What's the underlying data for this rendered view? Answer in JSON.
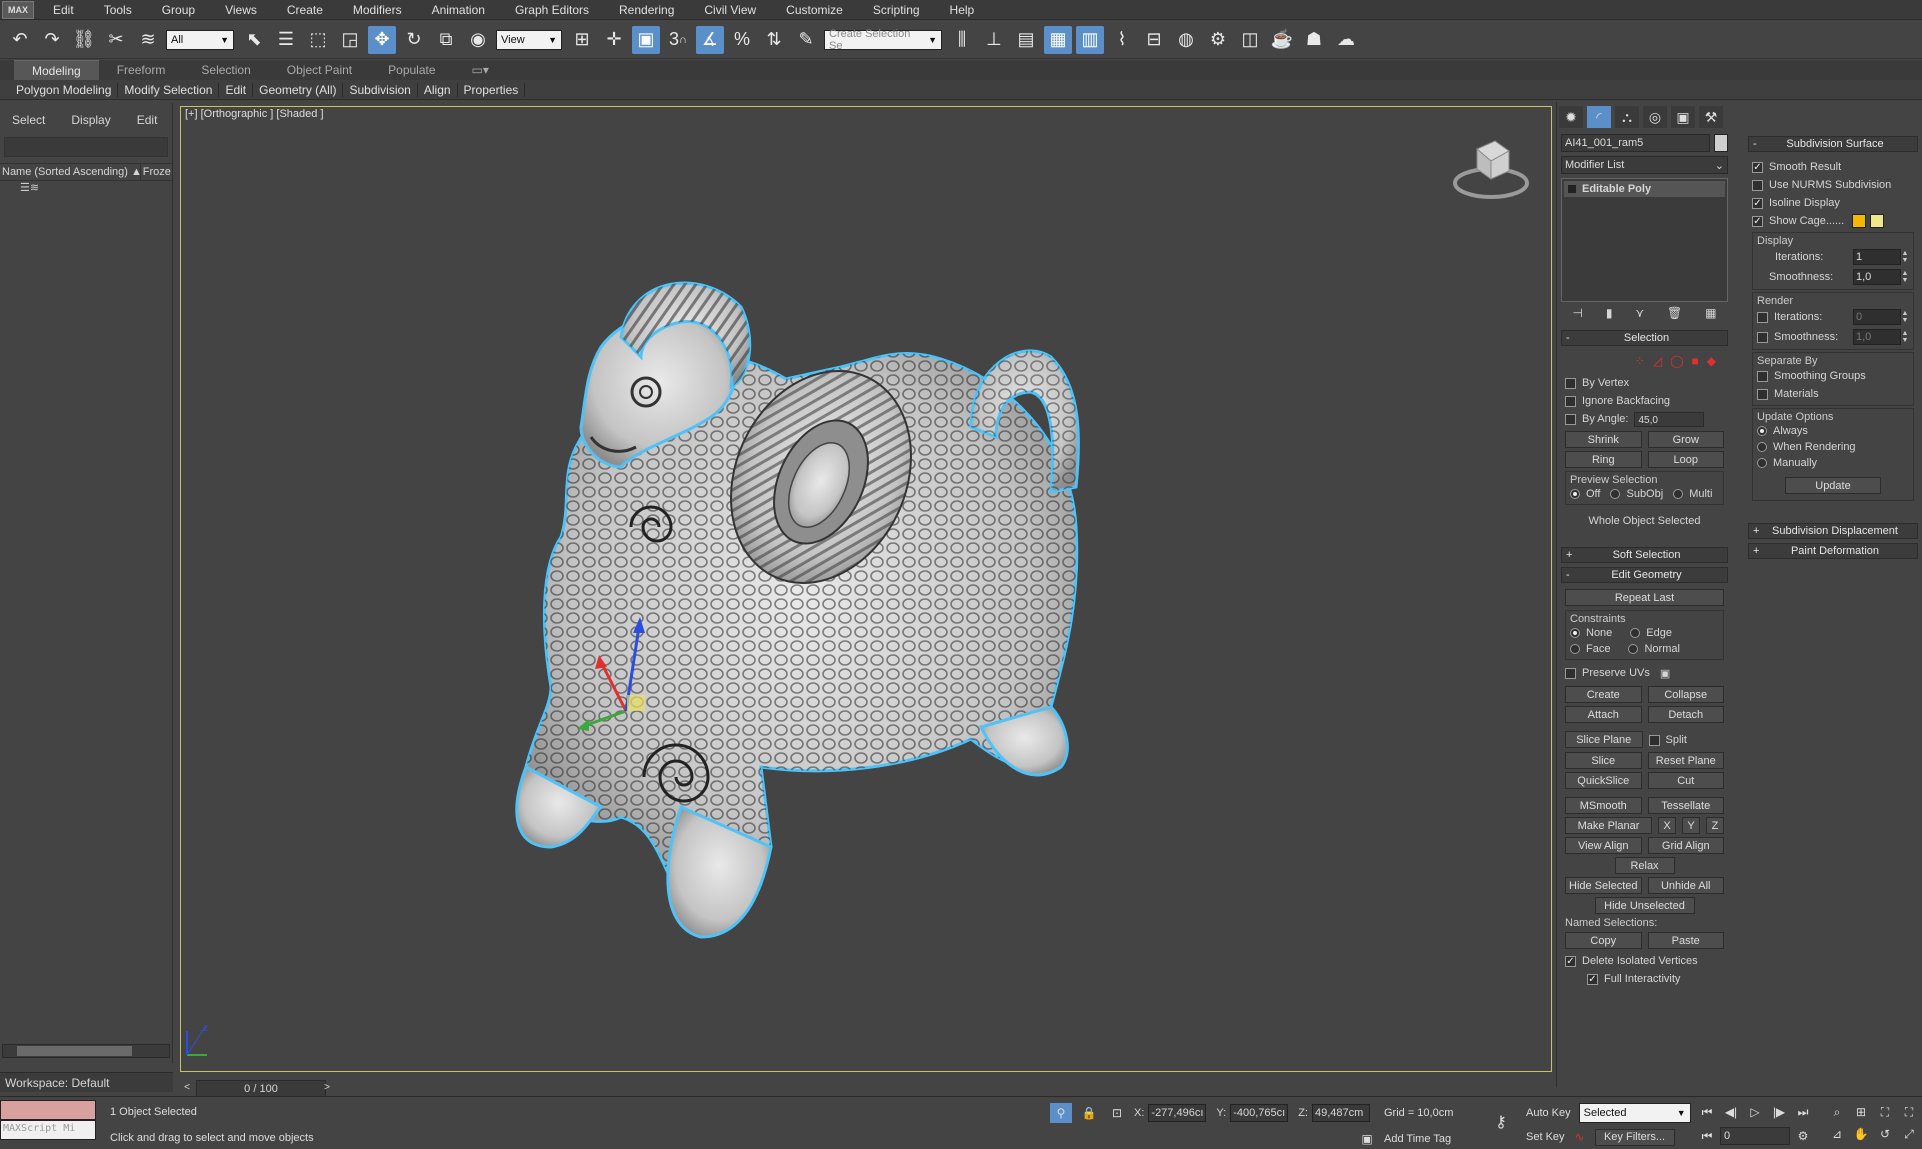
{
  "menubar": {
    "logo": "MAX",
    "items": [
      "Edit",
      "Tools",
      "Group",
      "Views",
      "Create",
      "Modifiers",
      "Animation",
      "Graph Editors",
      "Rendering",
      "Civil View",
      "Customize",
      "Scripting",
      "Help"
    ]
  },
  "toolbar": {
    "filter_value": "All",
    "refcoord_value": "View",
    "selection_set_placeholder": "Create Selection Se",
    "snap_label": "3",
    "angle_snap_label": "%"
  },
  "ribbon": {
    "tabs": [
      "Modeling",
      "Freeform",
      "Selection",
      "Object Paint",
      "Populate"
    ],
    "active_tab": "Modeling",
    "buttons": [
      "Polygon Modeling",
      "Modify Selection",
      "Edit",
      "Geometry (All)",
      "Subdivision",
      "Align",
      "Properties"
    ]
  },
  "explorer": {
    "tabs": [
      "Select",
      "Display",
      "Edit"
    ],
    "col_name": "Name (Sorted Ascending)",
    "col_frozen": "Froze",
    "workspace": "Workspace: Default"
  },
  "viewport": {
    "label": "[+] [Orthographic ] [Shaded ]",
    "border_color": "#c8c266",
    "selection_outline_color": "#4fc3f7"
  },
  "timeline": {
    "frame": "0 / 100"
  },
  "command_panel": {
    "object_name": "AI41_001_ram5",
    "modifier_list": "Modifier List",
    "stack_item": "Editable Poly",
    "selection": {
      "title": "Selection",
      "by_vertex": "By Vertex",
      "ignore_backfacing": "Ignore Backfacing",
      "by_angle": "By Angle:",
      "by_angle_value": "45,0",
      "shrink": "Shrink",
      "grow": "Grow",
      "ring": "Ring",
      "loop": "Loop",
      "preview_selection": "Preview Selection",
      "preview_off": "Off",
      "preview_subobj": "SubObj",
      "preview_multi": "Multi",
      "status": "Whole Object Selected"
    },
    "soft_selection": "Soft Selection",
    "edit_geometry": {
      "title": "Edit Geometry",
      "repeat_last": "Repeat Last",
      "constraints": "Constraints",
      "none": "None",
      "edge": "Edge",
      "face": "Face",
      "normal": "Normal",
      "preserve_uvs": "Preserve UVs",
      "create": "Create",
      "collapse": "Collapse",
      "attach": "Attach",
      "detach": "Detach",
      "slice_plane": "Slice Plane",
      "split": "Split",
      "slice": "Slice",
      "reset_plane": "Reset Plane",
      "quickslice": "QuickSlice",
      "cut": "Cut",
      "msmooth": "MSmooth",
      "tessellate": "Tessellate",
      "make_planar": "Make Planar",
      "x": "X",
      "y": "Y",
      "z": "Z",
      "view_align": "View Align",
      "grid_align": "Grid Align",
      "relax": "Relax",
      "hide_selected": "Hide Selected",
      "unhide_all": "Unhide All",
      "hide_unselected": "Hide Unselected",
      "named_selections": "Named Selections:",
      "copy": "Copy",
      "paste": "Paste",
      "delete_isolated": "Delete Isolated Vertices",
      "full_interactivity": "Full Interactivity"
    }
  },
  "subdivision": {
    "title": "Subdivision Surface",
    "smooth_result": "Smooth Result",
    "use_nurms": "Use NURMS Subdivision",
    "isoline": "Isoline Display",
    "show_cage": "Show Cage......",
    "cage_color_1": "#f5b800",
    "cage_color_2": "#f0e68c",
    "display": "Display",
    "iterations": "Iterations:",
    "display_iterations": "1",
    "smoothness": "Smoothness:",
    "display_smoothness": "1,0",
    "render": "Render",
    "render_iterations": "0",
    "render_smoothness": "1,0",
    "separate_by": "Separate By",
    "smoothing_groups": "Smoothing Groups",
    "materials": "Materials",
    "update_options": "Update Options",
    "always": "Always",
    "when_rendering": "When Rendering",
    "manually": "Manually",
    "update": "Update",
    "displacement": "Subdivision Displacement",
    "paint_deformation": "Paint Deformation"
  },
  "statusbar": {
    "objects_selected": "1 Object Selected",
    "prompt": "Click and drag to select and move objects",
    "maxscript": "MAXScript Mi",
    "x_label": "X:",
    "x_value": "-277,496cı",
    "y_label": "Y:",
    "y_value": "-400,765cı",
    "z_label": "Z:",
    "z_value": "49,487cm",
    "grid": "Grid = 10,0cm",
    "add_time_tag": "Add Time Tag",
    "auto_key": "Auto Key",
    "set_key": "Set Key",
    "key_mode": "Selected",
    "key_filters": "Key Filters...",
    "frame_value": "0"
  }
}
